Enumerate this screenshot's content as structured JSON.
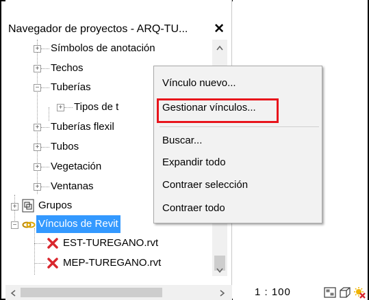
{
  "panel": {
    "title": "Navegador de proyectos - ARQ-TU...",
    "close_glyph": "✕"
  },
  "tree": {
    "items": [
      {
        "label": "Símbolos de anotación",
        "expander": "+"
      },
      {
        "label": "Techos",
        "expander": "+"
      },
      {
        "label": "Tuberías",
        "expander": "−"
      },
      {
        "label": "Tipos de t",
        "expander": "+"
      },
      {
        "label": "Tuberías flexil",
        "expander": "+"
      },
      {
        "label": "Tubos",
        "expander": "+"
      },
      {
        "label": "Vegetación",
        "expander": "+"
      },
      {
        "label": "Ventanas",
        "expander": "+"
      },
      {
        "label": "Grupos",
        "expander": "+"
      },
      {
        "label": "Vínculos de Revit",
        "expander": "−",
        "selected": true
      },
      {
        "label": "EST-TUREGANO.rvt",
        "status": "error"
      },
      {
        "label": "MEP-TUREGANO.rvt",
        "status": "error"
      }
    ]
  },
  "context_menu": {
    "items": [
      {
        "label": "Vínculo nuevo..."
      },
      {
        "label": "Gestionar vínculos...",
        "highlighted": true
      },
      {
        "label": "Buscar..."
      },
      {
        "label": "Expandir todo"
      },
      {
        "label": "Contraer selección"
      },
      {
        "label": "Contraer todo"
      }
    ]
  },
  "statusbar": {
    "scale": "1 : 100"
  },
  "colors": {
    "selection": "#3399ff",
    "highlight_box": "#e8141b",
    "error_icon": "#d9272e"
  }
}
